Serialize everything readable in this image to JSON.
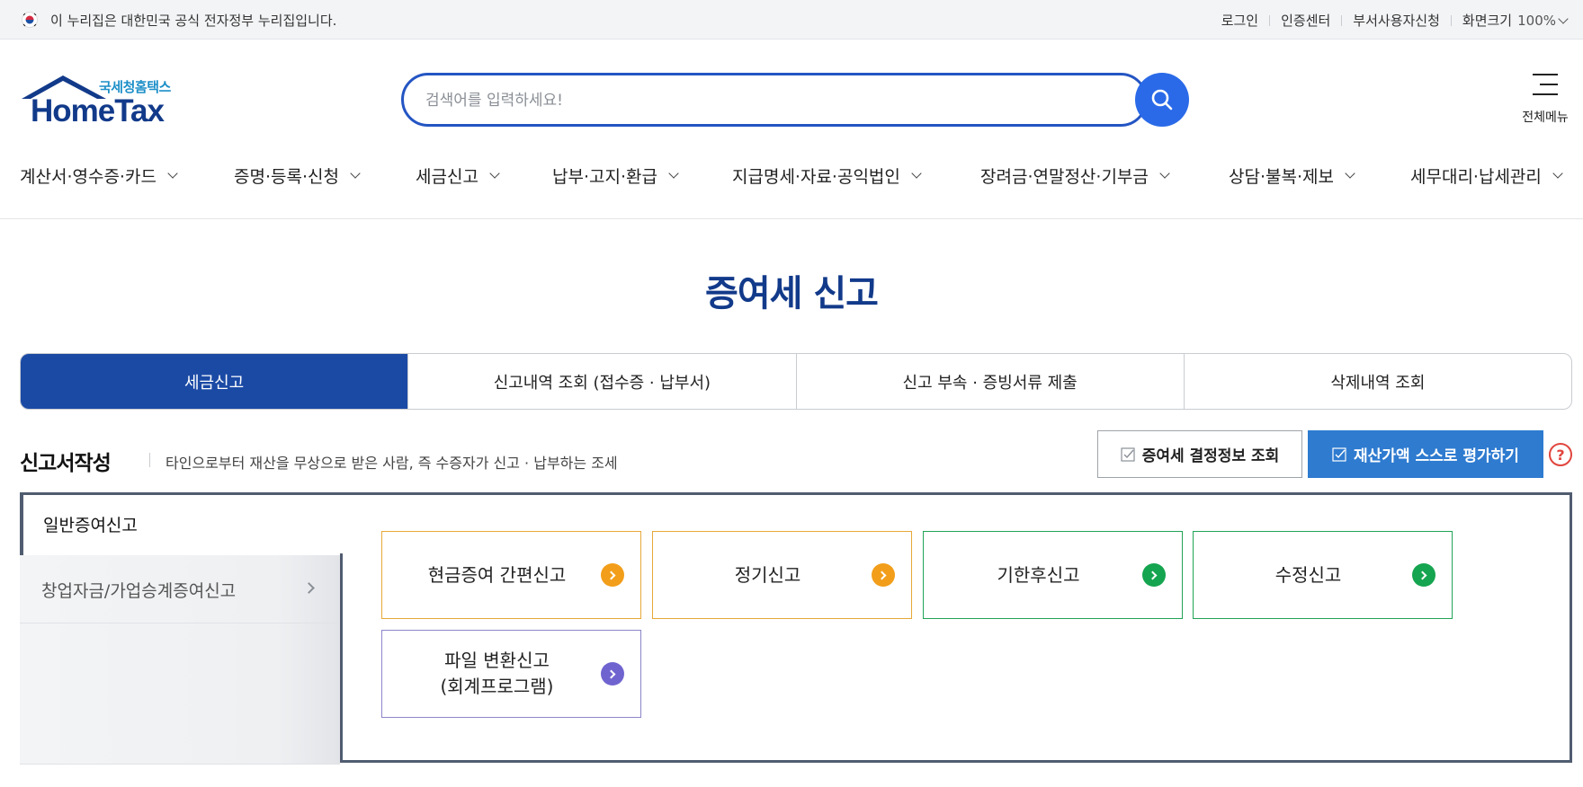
{
  "gov_banner": {
    "text": "이 누리집은 대한민국 공식 전자정부 누리집입니다."
  },
  "utility_nav": {
    "login": "로그인",
    "cert_center": "인증센터",
    "dept_user": "부서사용자신청",
    "screen_size_label": "화면크기",
    "screen_size_value": "100%"
  },
  "logo": {
    "sub": "국세청홈택스",
    "main": "HomeTax"
  },
  "search": {
    "placeholder": "검색어를 입력하세요!",
    "value": ""
  },
  "all_menu": {
    "label": "전체메뉴"
  },
  "gnb": [
    {
      "label": "계산서·영수증·카드"
    },
    {
      "label": "증명·등록·신청"
    },
    {
      "label": "세금신고"
    },
    {
      "label": "납부·고지·환급"
    },
    {
      "label": "지급명세·자료·공익법인"
    },
    {
      "label": "장려금·연말정산·기부금"
    },
    {
      "label": "상담·불복·제보"
    },
    {
      "label": "세무대리·납세관리"
    }
  ],
  "page_title": "증여세 신고",
  "tabs": [
    {
      "label": "세금신고",
      "active": true
    },
    {
      "label": "신고내역 조회 (접수증 · 납부서)",
      "active": false
    },
    {
      "label": "신고 부속 · 증빙서류 제출",
      "active": false
    },
    {
      "label": "삭제내역 조회",
      "active": false
    }
  ],
  "section": {
    "title": "신고서작성",
    "description": "타인으로부터 재산을 무상으로 받은 사람, 즉 수증자가 신고 · 납부하는 조세",
    "btn_decision_info": "증여세 결정정보 조회",
    "btn_self_eval": "재산가액 스스로 평가하기",
    "help": "?"
  },
  "side_menu": [
    {
      "label": "일반증여신고",
      "active": true
    },
    {
      "label": "창업자금/가업승계증여신고",
      "active": false
    }
  ],
  "cards": [
    {
      "label": "현금증여 간편신고",
      "color": "#f29e1a"
    },
    {
      "label": "정기신고",
      "color": "#f29e1a"
    },
    {
      "label": "기한후신고",
      "color": "#15a44f"
    },
    {
      "label": "수정신고",
      "color": "#15a44f"
    },
    {
      "label_line1": "파일 변환신고",
      "label_line2": "(회계프로그램)",
      "color": "#6f64cf"
    }
  ],
  "colors": {
    "primary": "#1b4aa5",
    "title": "#123a8a",
    "search_btn": "#2a6ae8",
    "accent_button": "#2e7bd0",
    "help": "#e0463e"
  }
}
